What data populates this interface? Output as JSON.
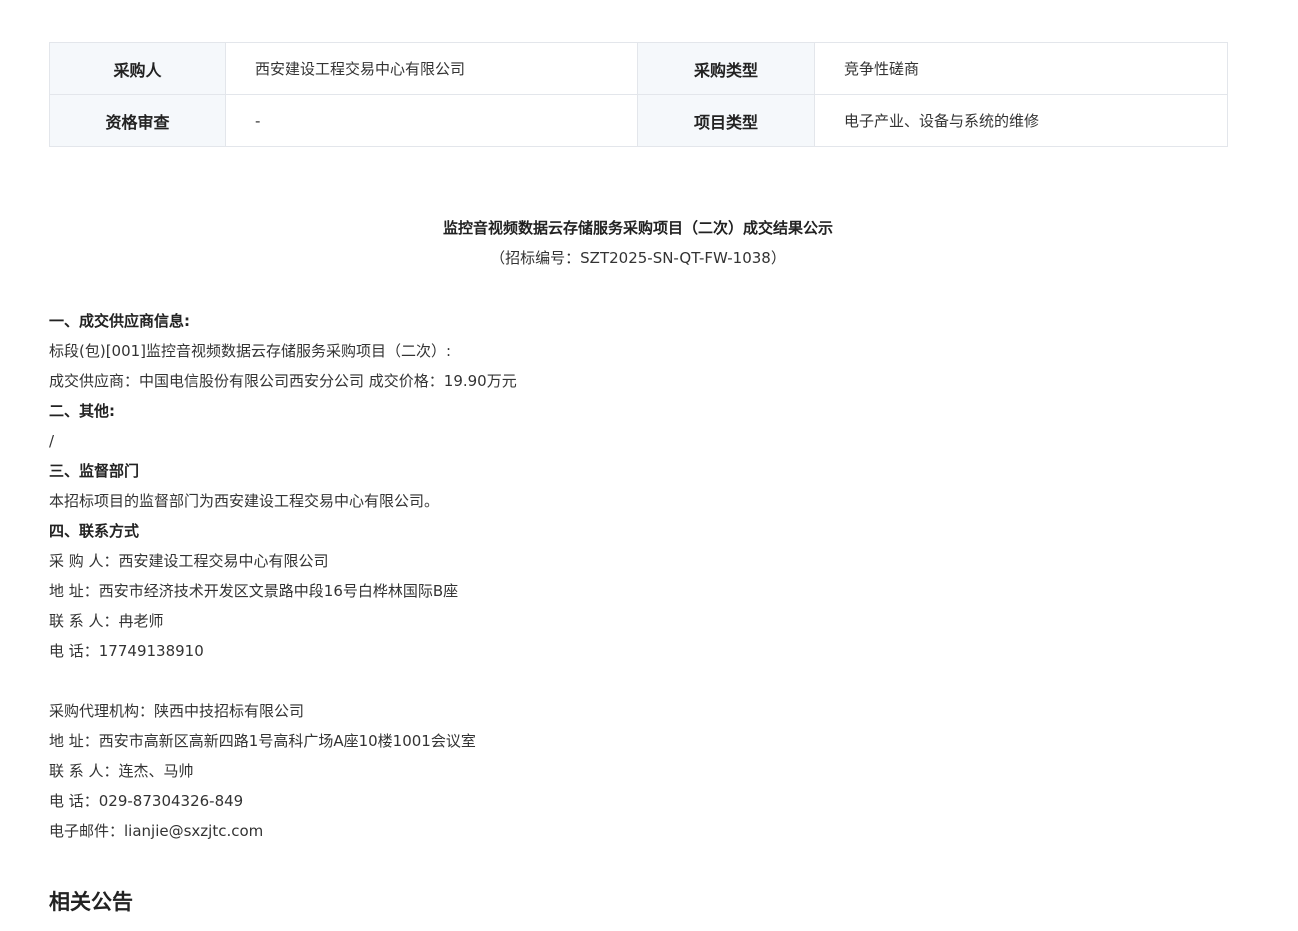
{
  "info_table": {
    "rows": [
      {
        "label1": "采购人",
        "value1": "西安建设工程交易中心有限公司",
        "label2": "采购类型",
        "value2": "竞争性磋商"
      },
      {
        "label1": "资格审查",
        "value1": "-",
        "label2": "项目类型",
        "value2": "电子产业、设备与系统的维修"
      }
    ]
  },
  "notice": {
    "title": "监控音视频数据云存储服务采购项目（二次）成交结果公示",
    "subtitle": "（招标编号：SZT2025-SN-QT-FW-1038）"
  },
  "content": {
    "sec1_heading": "一、成交供应商信息:",
    "sec1_line1": "标段(包)[001]监控音视频数据云存储服务采购项目（二次）:",
    "sec1_line2": "成交供应商：中国电信股份有限公司西安分公司 成交价格：19.90万元",
    "sec2_heading": "二、其他:",
    "sec2_line1": "/",
    "sec3_heading": "三、监督部门",
    "sec3_line1": "本招标项目的监督部门为西安建设工程交易中心有限公司。",
    "sec4_heading": "四、联系方式",
    "buyer_name": "采 购 人：西安建设工程交易中心有限公司",
    "buyer_address": "地 址：西安市经济技术开发区文景路中段16号白桦林国际B座",
    "buyer_contact": "联 系 人：冉老师",
    "buyer_phone": "电 话：17749138910",
    "agent_name": "采购代理机构：陕西中技招标有限公司",
    "agent_address": "地 址：西安市高新区高新四路1号高科广场A座10楼1001会议室",
    "agent_contact": "联 系 人：连杰、马帅",
    "agent_phone": "电 话：029-87304326-849",
    "agent_email": "电子邮件：lianjie@sxzjtc.com"
  },
  "related": {
    "heading": "相关公告"
  }
}
